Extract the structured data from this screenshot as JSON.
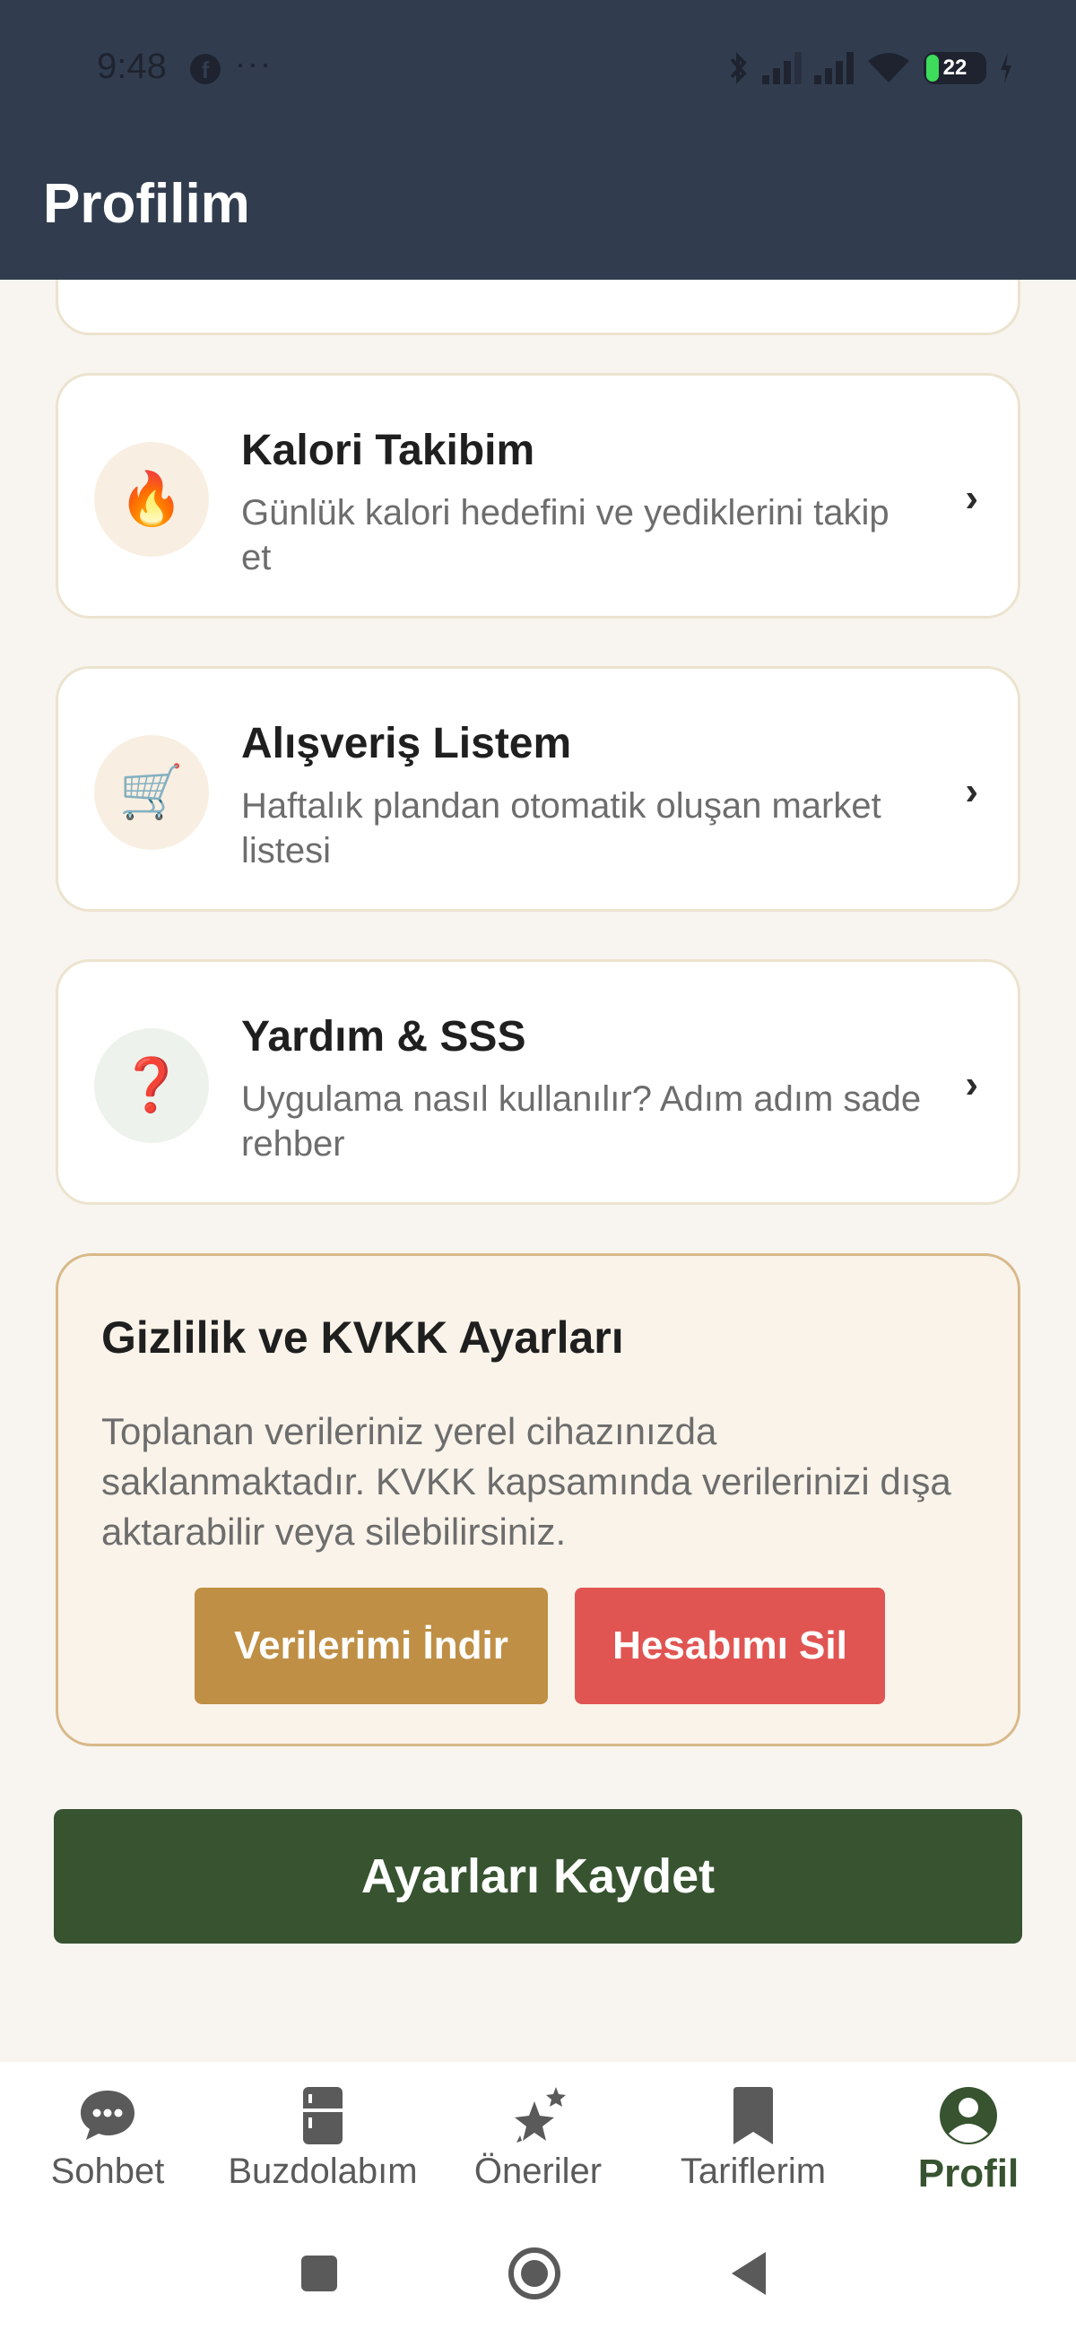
{
  "status_bar": {
    "time": "9:48",
    "battery": "22"
  },
  "header": {
    "title": "Profilim"
  },
  "menu_cards": [
    {
      "title": "Kalori Takibim",
      "description": "Günlük kalori hedefini ve yediklerini takip et",
      "icon": "fire-icon",
      "icon_glyph": "🔥"
    },
    {
      "title": "Alışveriş Listem",
      "description": "Haftalık plandan otomatik oluşan market listesi",
      "icon": "shopping-cart-icon",
      "icon_glyph": "🛒"
    },
    {
      "title": "Yardım & SSS",
      "description": "Uygulama nasıl kullanılır? Adım adım sade rehber",
      "icon": "question-mark-icon",
      "icon_glyph": "❓"
    }
  ],
  "privacy": {
    "title": "Gizlilik ve KVKK Ayarları",
    "text": "Toplanan verileriniz yerel cihazınızda saklanmaktadır. KVKK kapsamında verilerinizi dışa aktarabilir veya silebilirsiniz.",
    "export_label": "Verilerimi İndir",
    "delete_label": "Hesabımı Sil"
  },
  "save_label": "Ayarları Kaydet",
  "bottom_nav": [
    {
      "label": "Sohbet",
      "icon": "chat-icon"
    },
    {
      "label": "Buzdolabım",
      "icon": "fridge-icon"
    },
    {
      "label": "Öneriler",
      "icon": "sparkle-icon"
    },
    {
      "label": "Tariflerim",
      "icon": "bookmark-icon"
    },
    {
      "label": "Profil",
      "icon": "profile-icon",
      "active": true
    }
  ],
  "colors": {
    "header_bg": "#313d4f",
    "accent_green": "#375330",
    "export_button": "#bf8f45",
    "delete_button": "#e05552",
    "page_bg": "#f8f5f0"
  }
}
